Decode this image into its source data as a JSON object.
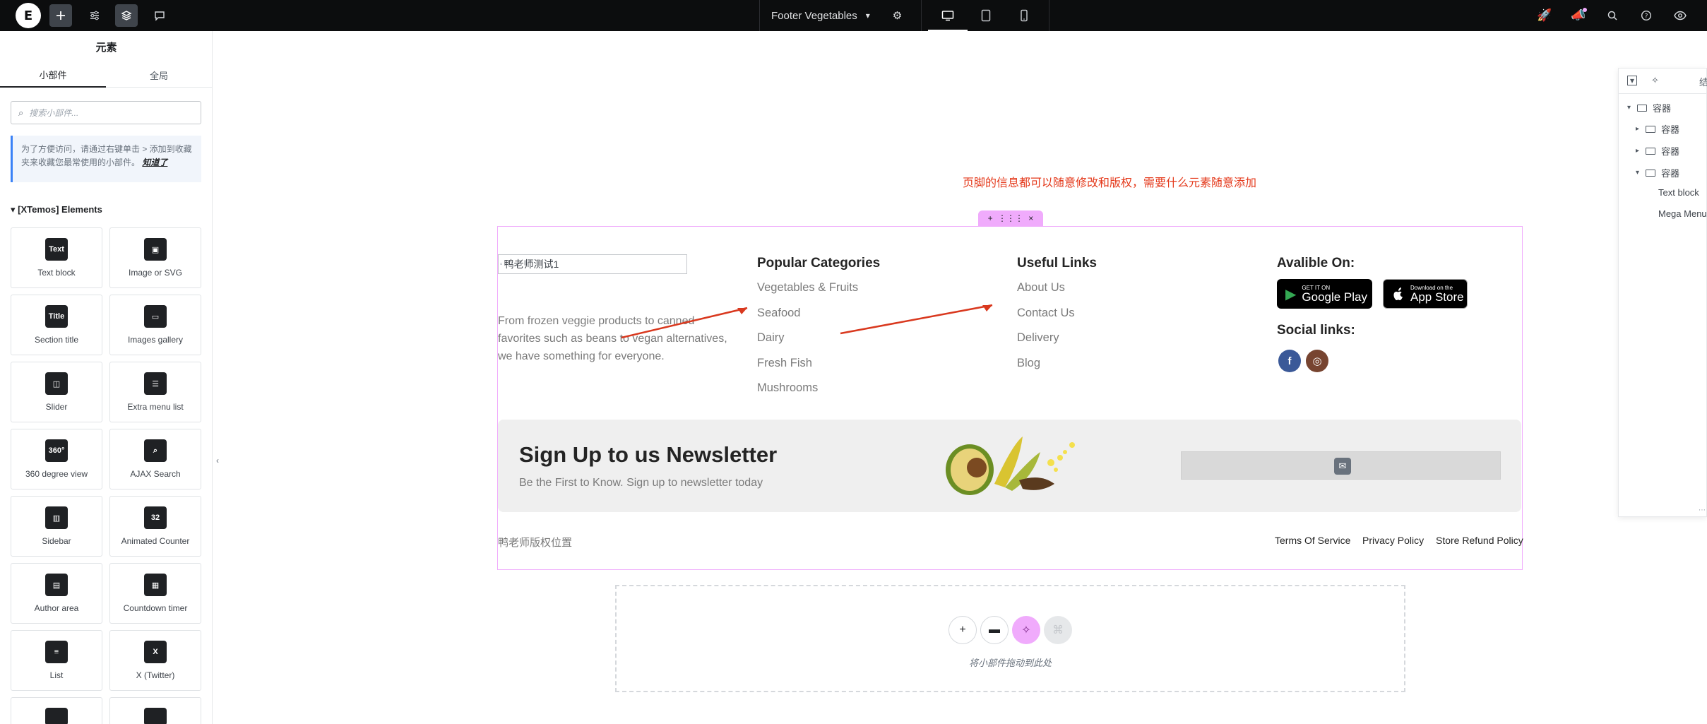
{
  "topbar": {
    "logo_letter": "E",
    "document_title": "Footer Vegetables",
    "chevron": "⌄",
    "left_icons": [
      "add-icon",
      "sliders-icon",
      "layers-icon",
      "comments-icon"
    ],
    "right_icons": [
      "rocket-icon",
      "megaphone-icon",
      "search-icon",
      "help-icon",
      "preview-eye-icon"
    ],
    "devices": [
      "desktop-icon",
      "tablet-icon",
      "mobile-icon"
    ]
  },
  "left_panel": {
    "title": "元素",
    "tabs": [
      "小部件",
      "全局"
    ],
    "search_placeholder": "搜索小部件...",
    "notice_text": "为了方便访问，请通过右键单击 > 添加到收藏夹来收藏您最常使用的小部件。",
    "notice_link": "知道了",
    "category": "[XTemos] Elements",
    "widgets": [
      {
        "label": "Text block",
        "glyph": "Text"
      },
      {
        "label": "Image or SVG",
        "glyph": "▣"
      },
      {
        "label": "Section title",
        "glyph": "Title"
      },
      {
        "label": "Images gallery",
        "glyph": "▭"
      },
      {
        "label": "Slider",
        "glyph": "◫"
      },
      {
        "label": "Extra menu list",
        "glyph": "☰"
      },
      {
        "label": "360 degree view",
        "glyph": "360°"
      },
      {
        "label": "AJAX Search",
        "glyph": "⌕"
      },
      {
        "label": "Sidebar",
        "glyph": "▥"
      },
      {
        "label": "Animated Counter",
        "glyph": "32"
      },
      {
        "label": "Author area",
        "glyph": "▤"
      },
      {
        "label": "Countdown timer",
        "glyph": "▦"
      },
      {
        "label": "List",
        "glyph": "≡"
      },
      {
        "label": "X (Twitter)",
        "glyph": "X"
      }
    ]
  },
  "canvas": {
    "annotation": "页脚的信息都可以随意修改和版权，需要什么元素随意添加",
    "section_toolbar": [
      "+",
      "⋮⋮⋮",
      "×"
    ],
    "footer": {
      "logo_alt": "鸭老师测试1",
      "description": "From frozen veggie products to canned favorites such as beans to vegan alternatives, we have something for everyone.",
      "columns": [
        {
          "title": "Popular Categories",
          "links": [
            "Vegetables & Fruits",
            "Seafood",
            "Dairy",
            "Fresh Fish",
            "Mushrooms"
          ]
        },
        {
          "title": "Useful Links",
          "links": [
            "About Us",
            "Contact Us",
            "Delivery",
            "Blog"
          ]
        }
      ],
      "available_title": "Avalible On:",
      "stores": [
        {
          "small": "GET IT ON",
          "big": "Google Play",
          "symbol": "▶"
        },
        {
          "small": "Download on the",
          "big": "App Store",
          "symbol": ""
        }
      ],
      "social_title": "Social links:",
      "social": [
        {
          "name": "facebook-icon",
          "glyph": "f",
          "color": "#3b5998"
        },
        {
          "name": "instagram-icon",
          "glyph": "◎",
          "color": "#774430"
        }
      ],
      "newsletter": {
        "title": "Sign Up to us Newsletter",
        "subtitle": "Be the First to Know. Sign up to newsletter today"
      },
      "copyright": "鸭老师版权位置",
      "legal_links": [
        "Terms Of Service",
        "Privacy Policy",
        "Store Refund Policy"
      ]
    },
    "dropzone": {
      "text": "将小部件拖动到此处",
      "buttons": [
        "+",
        "▬",
        "✧",
        "⌘"
      ]
    }
  },
  "navigator": {
    "items": [
      {
        "label": "容器",
        "caret": "▾",
        "level": 0
      },
      {
        "label": "容器",
        "caret": "▸",
        "level": 1
      },
      {
        "label": "容器",
        "caret": "▸",
        "level": 1
      },
      {
        "label": "容器",
        "caret": "▾",
        "level": 1
      },
      {
        "label": "Text block",
        "caret": "",
        "level": 2
      },
      {
        "label": "Mega Menu",
        "caret": "",
        "level": 2
      }
    ],
    "header_text": "结"
  },
  "colors": {
    "accent_pink": "#f0abfc",
    "annotation_red": "#e4391b",
    "topbar_bg": "#0c0d0e"
  }
}
